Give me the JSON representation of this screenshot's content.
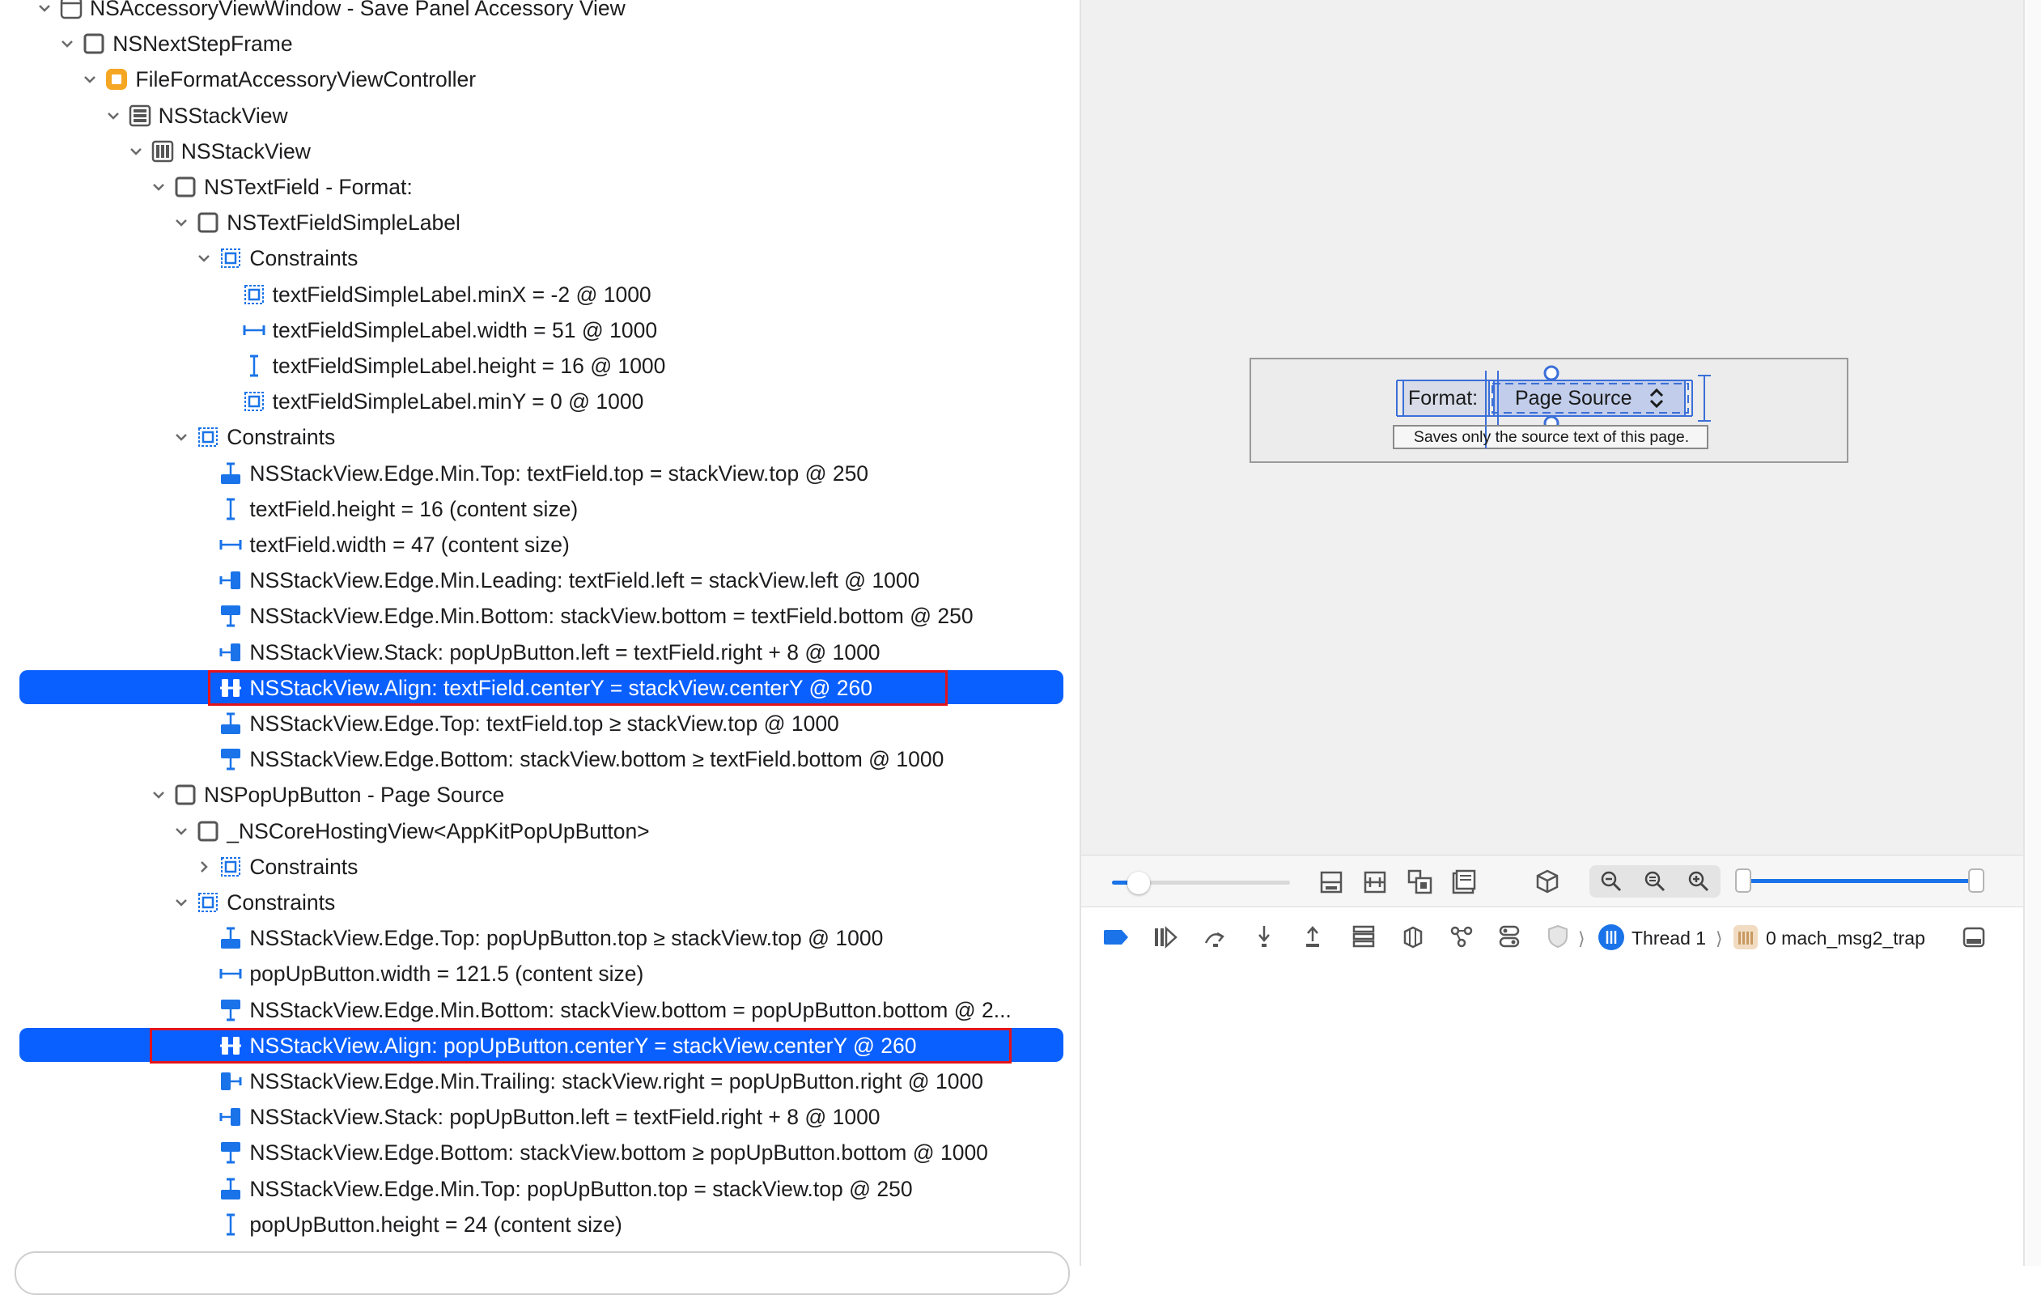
{
  "outline": {
    "rows": [
      {
        "label": "NSAccessoryViewWindow - Save Panel Accessory View",
        "icon": "window-icon",
        "indent": 0,
        "chevron": "open"
      },
      {
        "label": "NSNextStepFrame",
        "icon": "view-icon",
        "indent": 1,
        "chevron": "open"
      },
      {
        "label": "FileFormatAccessoryViewController",
        "icon": "view-controller-icon",
        "indent": 2,
        "chevron": "open"
      },
      {
        "label": "NSStackView",
        "icon": "stack-vertical-icon",
        "indent": 3,
        "chevron": "open"
      },
      {
        "label": "NSStackView",
        "icon": "stack-horizontal-icon",
        "indent": 4,
        "chevron": "open"
      },
      {
        "label": "NSTextField - Format:",
        "icon": "view-icon",
        "indent": 5,
        "chevron": "open"
      },
      {
        "label": "NSTextFieldSimpleLabel",
        "icon": "view-icon",
        "indent": 6,
        "chevron": "open"
      },
      {
        "label": "Constraints",
        "icon": "constraints-icon",
        "indent": 7,
        "chevron": "open"
      },
      {
        "label": "textFieldSimpleLabel.minX = -2 @ 1000",
        "icon": "constraints-icon",
        "indent": 8,
        "chevron": "none"
      },
      {
        "label": "textFieldSimpleLabel.width = 51 @ 1000",
        "icon": "width-constraint-icon",
        "indent": 8,
        "chevron": "none"
      },
      {
        "label": "textFieldSimpleLabel.height = 16 @ 1000",
        "icon": "height-constraint-icon",
        "indent": 8,
        "chevron": "none"
      },
      {
        "label": "textFieldSimpleLabel.minY = 0 @ 1000",
        "icon": "constraints-icon",
        "indent": 8,
        "chevron": "none"
      },
      {
        "label": "Constraints",
        "icon": "constraints-icon",
        "indent": 6,
        "chevron": "open"
      },
      {
        "label": "NSStackView.Edge.Min.Top: textField.top = stackView.top @ 250",
        "icon": "top-constraint-icon",
        "indent": 7,
        "chevron": "none"
      },
      {
        "label": "textField.height = 16 (content size)",
        "icon": "height-constraint-icon",
        "indent": 7,
        "chevron": "none"
      },
      {
        "label": "textField.width = 47 (content size)",
        "icon": "width-constraint-icon",
        "indent": 7,
        "chevron": "none"
      },
      {
        "label": "NSStackView.Edge.Min.Leading: textField.left = stackView.left @ 1000",
        "icon": "leading-constraint-icon",
        "indent": 7,
        "chevron": "none"
      },
      {
        "label": "NSStackView.Edge.Min.Bottom: stackView.bottom = textField.bottom @ 250",
        "icon": "bottom-constraint-icon",
        "indent": 7,
        "chevron": "none"
      },
      {
        "label": "NSStackView.Stack: popUpButton.left = textField.right + 8 @ 1000",
        "icon": "leading-constraint-icon",
        "indent": 7,
        "chevron": "none"
      },
      {
        "label": "NSStackView.Align: textField.centerY = stackView.centerY @ 260",
        "icon": "center-y-constraint-icon",
        "indent": 7,
        "chevron": "none",
        "selected": true
      },
      {
        "label": "NSStackView.Edge.Top: textField.top ≥ stackView.top @ 1000",
        "icon": "top-constraint-icon",
        "indent": 7,
        "chevron": "none"
      },
      {
        "label": "NSStackView.Edge.Bottom: stackView.bottom ≥ textField.bottom @ 1000",
        "icon": "bottom-constraint-icon",
        "indent": 7,
        "chevron": "none"
      },
      {
        "label": "NSPopUpButton - Page Source",
        "icon": "view-icon",
        "indent": 5,
        "chevron": "open"
      },
      {
        "label": "_NSCoreHostingView<AppKitPopUpButton>",
        "icon": "view-icon",
        "indent": 6,
        "chevron": "open"
      },
      {
        "label": "Constraints",
        "icon": "constraints-icon",
        "indent": 7,
        "chevron": "closed"
      },
      {
        "label": "Constraints",
        "icon": "constraints-icon",
        "indent": 6,
        "chevron": "open"
      },
      {
        "label": "NSStackView.Edge.Top: popUpButton.top ≥ stackView.top @ 1000",
        "icon": "top-constraint-icon",
        "indent": 7,
        "chevron": "none"
      },
      {
        "label": "popUpButton.width = 121.5 (content size)",
        "icon": "width-constraint-icon",
        "indent": 7,
        "chevron": "none"
      },
      {
        "label": "NSStackView.Edge.Min.Bottom: stackView.bottom = popUpButton.bottom @ 2...",
        "icon": "bottom-constraint-icon",
        "indent": 7,
        "chevron": "none"
      },
      {
        "label": "NSStackView.Align: popUpButton.centerY = stackView.centerY @ 260",
        "icon": "center-y-constraint-icon",
        "indent": 7,
        "chevron": "none",
        "selected": true
      },
      {
        "label": "NSStackView.Edge.Min.Trailing: stackView.right = popUpButton.right @ 1000",
        "icon": "trailing-constraint-icon",
        "indent": 7,
        "chevron": "none"
      },
      {
        "label": "NSStackView.Stack: popUpButton.left = textField.right + 8 @ 1000",
        "icon": "leading-constraint-icon",
        "indent": 7,
        "chevron": "none"
      },
      {
        "label": "NSStackView.Edge.Bottom: stackView.bottom ≥ popUpButton.bottom @ 1000",
        "icon": "bottom-constraint-icon",
        "indent": 7,
        "chevron": "none"
      },
      {
        "label": "NSStackView.Edge.Min.Top: popUpButton.top = stackView.top @ 250",
        "icon": "top-constraint-icon",
        "indent": 7,
        "chevron": "none"
      },
      {
        "label": "popUpButton.height = 24 (content size)",
        "icon": "height-constraint-icon",
        "indent": 7,
        "chevron": "none"
      }
    ]
  },
  "preview": {
    "format_label": "Format:",
    "popup_value": "Page Source",
    "hint_text": "Saves only the source text of this page."
  },
  "canvas_toolbar": {
    "spacing_slider": 0.15,
    "range_slider_end": 1.0,
    "icons": [
      "clip-content-icon",
      "show-constraints-icon",
      "show-frames-icon",
      "changed-frames-icon",
      "3d-cube-icon",
      "zoom-out-icon",
      "zoom-actual-icon",
      "zoom-in-icon"
    ]
  },
  "debug_bar": {
    "thread_label": "Thread 1",
    "frame_label": "0 mach_msg2_trap",
    "icons": [
      "breakpoints-toggle-icon",
      "continue-icon",
      "step-over-icon",
      "step-into-icon",
      "step-out-icon",
      "view-hierarchy-icon",
      "memory-graph-icon",
      "environment-icon",
      "location-icon",
      "shield-icon"
    ]
  },
  "colors": {
    "selection": "#0a60ff",
    "accent": "#1a73e8",
    "highlight_box": "#e3131b",
    "controller_icon": "#f5a623"
  }
}
